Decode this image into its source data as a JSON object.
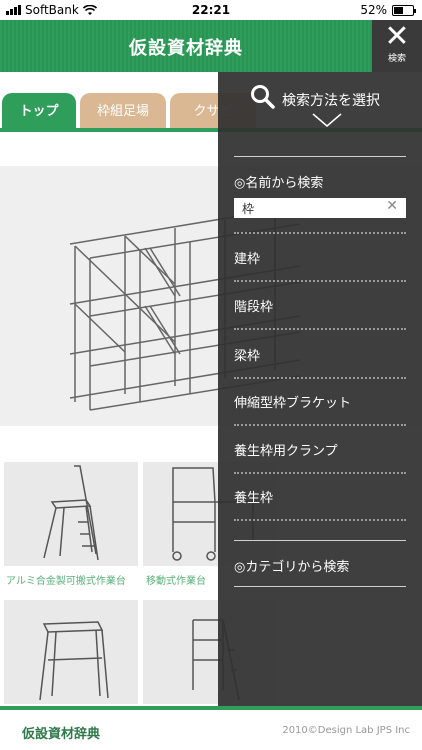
{
  "status": {
    "carrier": "SoftBank",
    "time": "22:21",
    "battery": "52%",
    "battery_level": 0.52
  },
  "header": {
    "title": "仮設資材辞典",
    "search_label": "検索"
  },
  "tabs": [
    {
      "label": "トップ"
    },
    {
      "label": "枠組足場"
    },
    {
      "label": "クサビ"
    }
  ],
  "products": [
    {
      "caption": "アルミ合金製可搬式作業台"
    },
    {
      "caption": "移動式作業台"
    }
  ],
  "footer": {
    "name": "仮設資材辞典",
    "copyright": "2010©Design Lab JPS Inc"
  },
  "drawer": {
    "title": "検索方法を選択",
    "name_search_title": "◎名前から検索",
    "search_value": "枠",
    "results": [
      "建枠",
      "階段枠",
      "梁枠",
      "伸縮型枠ブラケット",
      "養生枠用クランプ",
      "養生枠"
    ],
    "category_search_title": "◎カテゴリから検索"
  }
}
